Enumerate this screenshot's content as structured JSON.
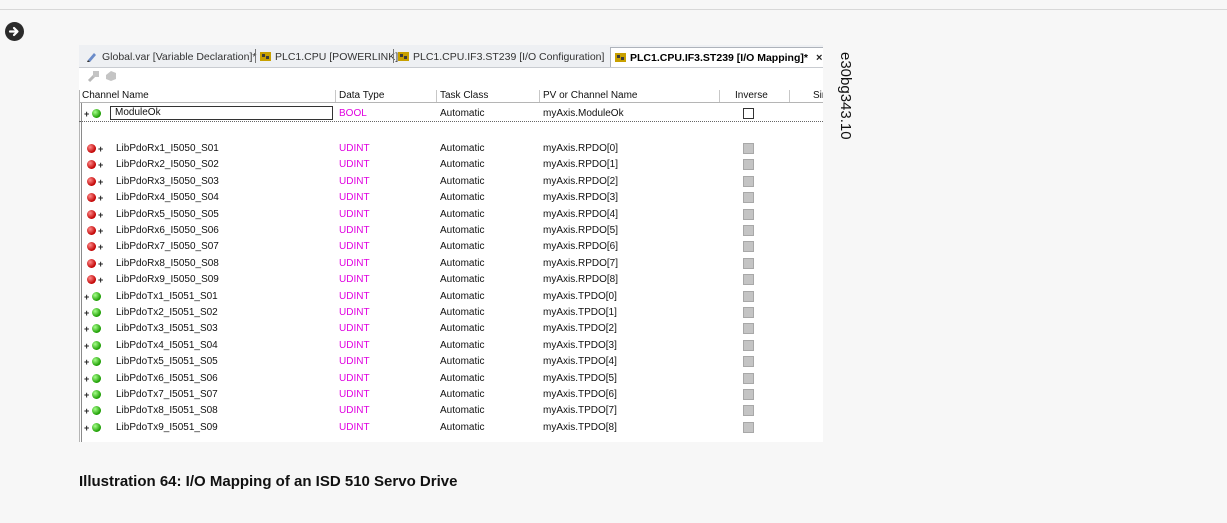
{
  "tabs": [
    {
      "label": "Global.var [Variable Declaration]*",
      "icon": "variable-file-icon"
    },
    {
      "label": "PLC1.CPU [POWERLINK]",
      "icon": "network-config-icon"
    },
    {
      "label": "PLC1.CPU.IF3.ST239 [I/O Configuration]",
      "icon": "network-config-icon"
    },
    {
      "label": "PLC1.CPU.IF3.ST239 [I/O Mapping]*",
      "icon": "network-config-icon",
      "active": true
    }
  ],
  "tab_close": "×",
  "columns": [
    "Channel Name",
    "Data Type",
    "Task Class",
    "PV or Channel Name",
    "Inverse",
    "Sir"
  ],
  "module_row": {
    "name": "ModuleOk",
    "type": "BOOL",
    "task": "Automatic",
    "pv": "myAxis.ModuleOk"
  },
  "rows": [
    {
      "name": "LibPdoRx1_I5050_S01",
      "dir": "in",
      "type": "UDINT",
      "task": "Automatic",
      "pv": "myAxis.RPDO[0]"
    },
    {
      "name": "LibPdoRx2_I5050_S02",
      "dir": "in",
      "type": "UDINT",
      "task": "Automatic",
      "pv": "myAxis.RPDO[1]"
    },
    {
      "name": "LibPdoRx3_I5050_S03",
      "dir": "in",
      "type": "UDINT",
      "task": "Automatic",
      "pv": "myAxis.RPDO[2]"
    },
    {
      "name": "LibPdoRx4_I5050_S04",
      "dir": "in",
      "type": "UDINT",
      "task": "Automatic",
      "pv": "myAxis.RPDO[3]"
    },
    {
      "name": "LibPdoRx5_I5050_S05",
      "dir": "in",
      "type": "UDINT",
      "task": "Automatic",
      "pv": "myAxis.RPDO[4]"
    },
    {
      "name": "LibPdoRx6_I5050_S06",
      "dir": "in",
      "type": "UDINT",
      "task": "Automatic",
      "pv": "myAxis.RPDO[5]"
    },
    {
      "name": "LibPdoRx7_I5050_S07",
      "dir": "in",
      "type": "UDINT",
      "task": "Automatic",
      "pv": "myAxis.RPDO[6]"
    },
    {
      "name": "LibPdoRx8_I5050_S08",
      "dir": "in",
      "type": "UDINT",
      "task": "Automatic",
      "pv": "myAxis.RPDO[7]"
    },
    {
      "name": "LibPdoRx9_I5050_S09",
      "dir": "in",
      "type": "UDINT",
      "task": "Automatic",
      "pv": "myAxis.RPDO[8]"
    },
    {
      "name": "LibPdoTx1_I5051_S01",
      "dir": "out",
      "type": "UDINT",
      "task": "Automatic",
      "pv": "myAxis.TPDO[0]"
    },
    {
      "name": "LibPdoTx2_I5051_S02",
      "dir": "out",
      "type": "UDINT",
      "task": "Automatic",
      "pv": "myAxis.TPDO[1]"
    },
    {
      "name": "LibPdoTx3_I5051_S03",
      "dir": "out",
      "type": "UDINT",
      "task": "Automatic",
      "pv": "myAxis.TPDO[2]"
    },
    {
      "name": "LibPdoTx4_I5051_S04",
      "dir": "out",
      "type": "UDINT",
      "task": "Automatic",
      "pv": "myAxis.TPDO[3]"
    },
    {
      "name": "LibPdoTx5_I5051_S05",
      "dir": "out",
      "type": "UDINT",
      "task": "Automatic",
      "pv": "myAxis.TPDO[4]"
    },
    {
      "name": "LibPdoTx6_I5051_S06",
      "dir": "out",
      "type": "UDINT",
      "task": "Automatic",
      "pv": "myAxis.TPDO[5]"
    },
    {
      "name": "LibPdoTx7_I5051_S07",
      "dir": "out",
      "type": "UDINT",
      "task": "Automatic",
      "pv": "myAxis.TPDO[6]"
    },
    {
      "name": "LibPdoTx8_I5051_S08",
      "dir": "out",
      "type": "UDINT",
      "task": "Automatic",
      "pv": "myAxis.TPDO[7]"
    },
    {
      "name": "LibPdoTx9_I5051_S09",
      "dir": "out",
      "type": "UDINT",
      "task": "Automatic",
      "pv": "myAxis.TPDO[8]"
    }
  ],
  "side_label": "e30bg343.10",
  "caption": "Illustration 64: I/O Mapping of an ISD 510 Servo Drive",
  "colors": {
    "datatype": "#e000e0",
    "input_led": "#c00000",
    "output_led": "#1a9b00"
  }
}
